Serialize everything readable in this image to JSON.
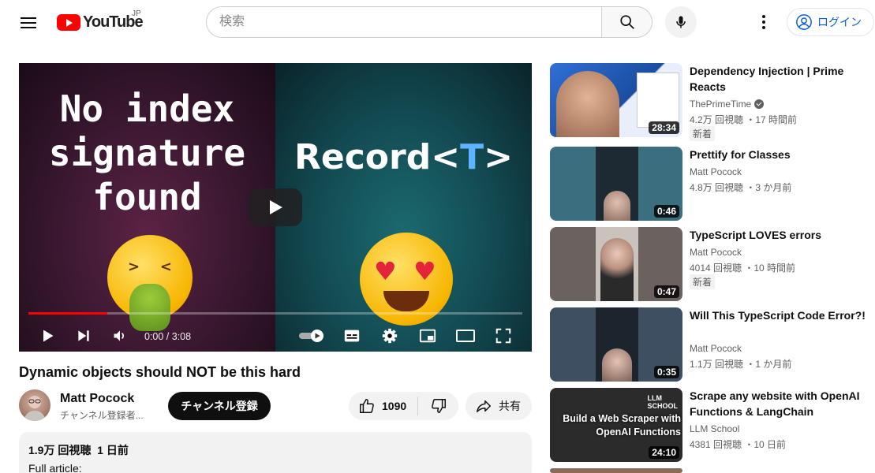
{
  "header": {
    "logo_text": "YouTube",
    "region": "JP",
    "search_placeholder": "検索",
    "login_label": "ログイン"
  },
  "player": {
    "left_text": "No index\nsignature\nfound",
    "right_text_prefix": "Record<",
    "right_text_letter": "T",
    "right_text_suffix": ">",
    "time": "0:00 / 3:08",
    "progress": 0.16
  },
  "video": {
    "title": "Dynamic objects should NOT be this hard",
    "channel": "Matt Pocock",
    "subscribers": "チャンネル登録者...",
    "subscribe_label": "チャンネル登録",
    "likes": "1090",
    "share_label": "共有",
    "views": "1.9万 回視聴",
    "age": "1 日前",
    "description": "Full article:"
  },
  "recommendations": [
    {
      "title": "Dependency Injection | Prime Reacts",
      "channel": "ThePrimeTime",
      "verified": true,
      "meta": "4.2万 回視聴 ・17 時間前",
      "badge": "新着",
      "duration": "28:34",
      "bg": "#1c4f9a"
    },
    {
      "title": "Prettify for Classes",
      "channel": "Matt Pocock",
      "verified": false,
      "meta": "4.8万 回視聴 ・3 か月前",
      "badge": "",
      "duration": "0:46",
      "bg": "#3b6f80"
    },
    {
      "title": "TypeScript LOVES errors",
      "channel": "Matt Pocock",
      "verified": false,
      "meta": "4014 回視聴 ・10 時間前",
      "badge": "新着",
      "duration": "0:47",
      "bg": "#6b6260"
    },
    {
      "title": "Will This TypeScript Code Error?!",
      "channel": "Matt Pocock",
      "verified": false,
      "meta": "1.1万 回視聴 ・1 か月前",
      "badge": "",
      "duration": "0:35",
      "bg": "#3d4f60"
    },
    {
      "title": "Scrape any website with OpenAI Functions & LangChain",
      "channel": "LLM School",
      "verified": false,
      "meta": "4381 回視聴 ・10 日前",
      "badge": "",
      "duration": "24:10",
      "bg": "#2b2b2b",
      "overlay_top": "LLM\nSCHOOL",
      "overlay_main": "Build a Web Scraper with\nOpenAI Functions"
    }
  ],
  "colors": {
    "accent": "#ff0000",
    "link": "#065fd4"
  }
}
